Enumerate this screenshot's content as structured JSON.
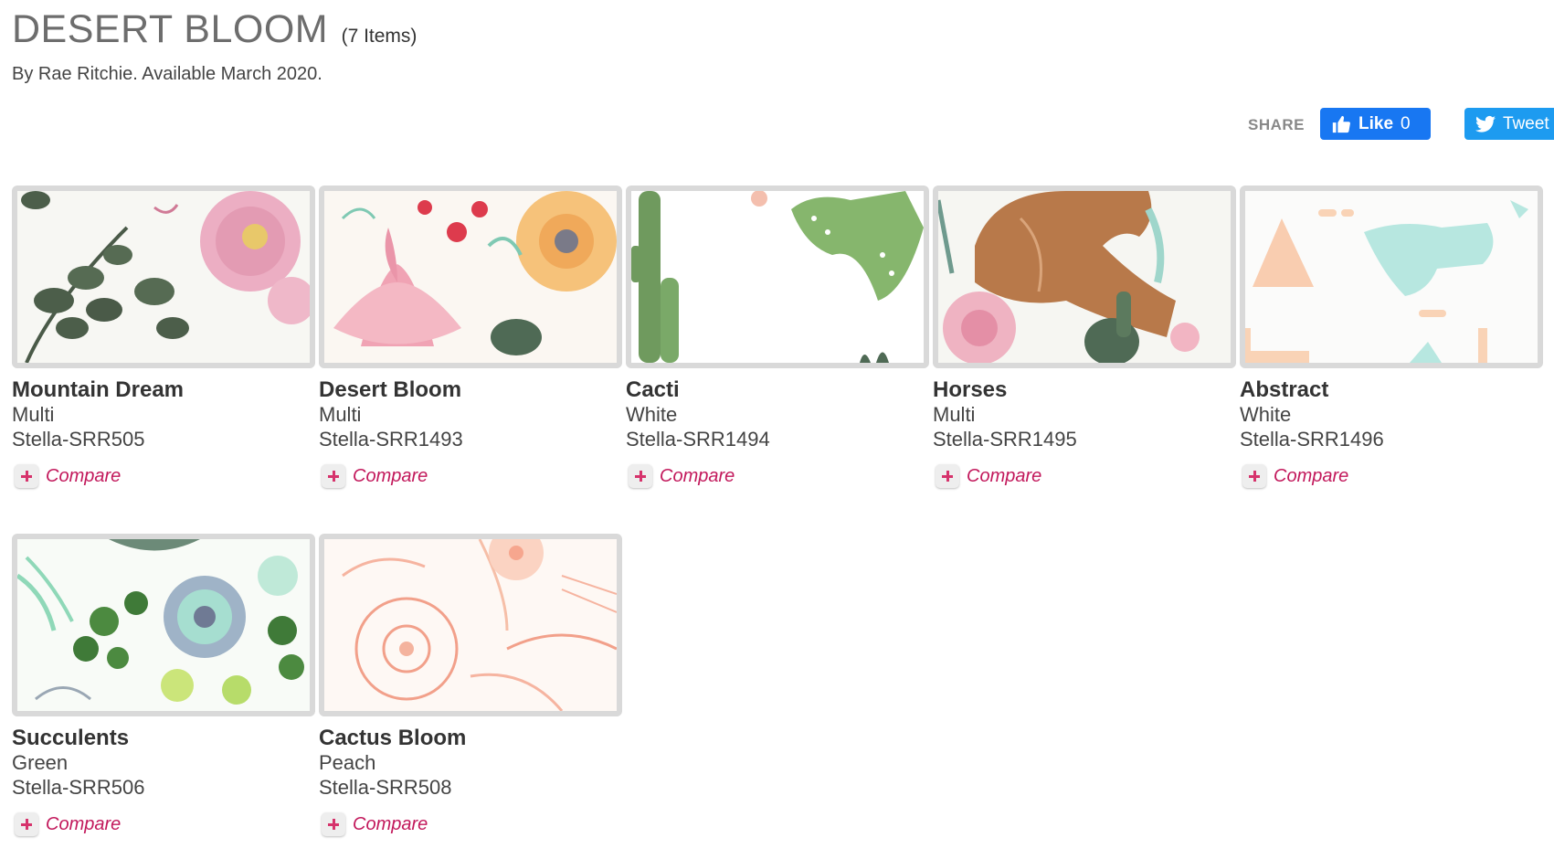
{
  "header": {
    "title": "DESERT BLOOM",
    "count": "(7 Items)",
    "byline": "By Rae Ritchie. Available March 2020."
  },
  "share": {
    "label": "SHARE",
    "like_label": "Like",
    "like_count": "0",
    "tweet_label": "Tweet"
  },
  "colors": {
    "like_bg": "#1877f2",
    "tweet_bg": "#1d9bf0",
    "compare_text": "#c2185b",
    "thumb_border": "#d9d9d9"
  },
  "products": [
    {
      "name": "Mountain Dream",
      "color": "Multi",
      "sku": "Stella-SRR505",
      "compare_label": "Compare",
      "icon": "plus-icon"
    },
    {
      "name": "Desert Bloom",
      "color": "Multi",
      "sku": "Stella-SRR1493",
      "compare_label": "Compare",
      "icon": "plus-icon"
    },
    {
      "name": "Cacti",
      "color": "White",
      "sku": "Stella-SRR1494",
      "compare_label": "Compare",
      "icon": "plus-icon"
    },
    {
      "name": "Horses",
      "color": "Multi",
      "sku": "Stella-SRR1495",
      "compare_label": "Compare",
      "icon": "plus-icon"
    },
    {
      "name": "Abstract",
      "color": "White",
      "sku": "Stella-SRR1496",
      "compare_label": "Compare",
      "icon": "plus-icon"
    },
    {
      "name": "Succulents",
      "color": "Green",
      "sku": "Stella-SRR506",
      "compare_label": "Compare",
      "icon": "plus-icon"
    },
    {
      "name": "Cactus Bloom",
      "color": "Peach",
      "sku": "Stella-SRR508",
      "compare_label": "Compare",
      "icon": "plus-icon"
    }
  ]
}
